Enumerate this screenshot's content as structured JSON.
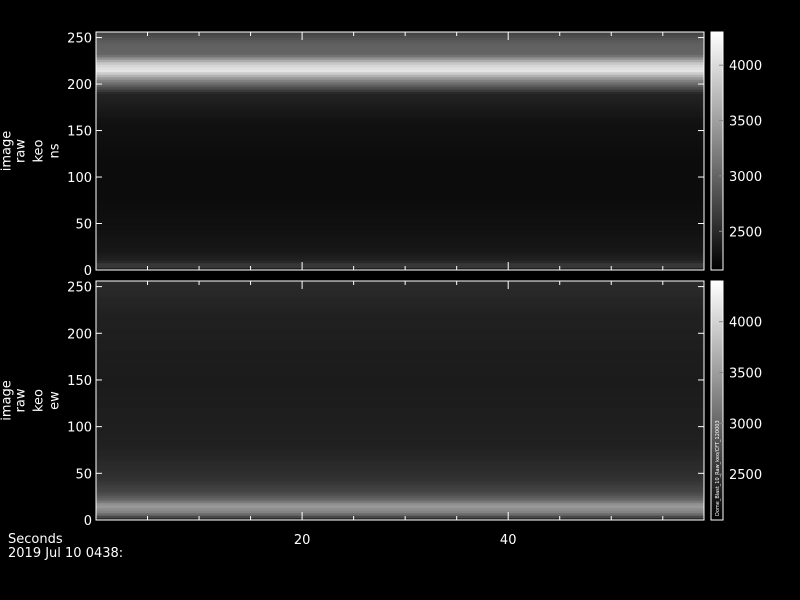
{
  "chart_data": [
    {
      "type": "heatmap",
      "ylabel": [
        "image",
        "raw",
        "keo",
        "ns"
      ],
      "xlim": [
        0,
        59
      ],
      "ylim": [
        0,
        256
      ],
      "yticks": [
        0,
        50,
        100,
        150,
        200,
        250
      ],
      "xticks": [
        20,
        40
      ],
      "colorbar": {
        "min": 2150,
        "max": 4300,
        "ticks": [
          2500,
          3000,
          3500,
          4000
        ]
      },
      "intensity_profile": [
        {
          "y": 0,
          "v": 2250
        },
        {
          "y": 5,
          "v": 2700
        },
        {
          "y": 10,
          "v": 2450
        },
        {
          "y": 20,
          "v": 2350
        },
        {
          "y": 40,
          "v": 2300
        },
        {
          "y": 80,
          "v": 2250
        },
        {
          "y": 120,
          "v": 2250
        },
        {
          "y": 160,
          "v": 2300
        },
        {
          "y": 190,
          "v": 2450
        },
        {
          "y": 205,
          "v": 3300
        },
        {
          "y": 215,
          "v": 4100
        },
        {
          "y": 222,
          "v": 3900
        },
        {
          "y": 232,
          "v": 3000
        },
        {
          "y": 245,
          "v": 2950
        },
        {
          "y": 256,
          "v": 2700
        }
      ]
    },
    {
      "type": "heatmap",
      "ylabel": [
        "image",
        "raw",
        "keo",
        "ew"
      ],
      "xlim": [
        0,
        59
      ],
      "ylim": [
        0,
        256
      ],
      "yticks": [
        0,
        50,
        100,
        150,
        200,
        250
      ],
      "xticks": [
        20,
        40
      ],
      "colorbar": {
        "min": 2050,
        "max": 4400,
        "ticks": [
          2500,
          3000,
          3500,
          4000
        ]
      },
      "colorbar_annotation": "Dome_Blast_10_Raw_keo/CFT_120003",
      "intensity_profile": [
        {
          "y": 0,
          "v": 2250
        },
        {
          "y": 8,
          "v": 3200
        },
        {
          "y": 16,
          "v": 3500
        },
        {
          "y": 22,
          "v": 3000
        },
        {
          "y": 30,
          "v": 2700
        },
        {
          "y": 45,
          "v": 2500
        },
        {
          "y": 80,
          "v": 2350
        },
        {
          "y": 150,
          "v": 2300
        },
        {
          "y": 220,
          "v": 2350
        },
        {
          "y": 256,
          "v": 2450
        }
      ]
    }
  ],
  "footer": {
    "xlabel": "Seconds",
    "date": "2019 Jul 10 0438:"
  }
}
